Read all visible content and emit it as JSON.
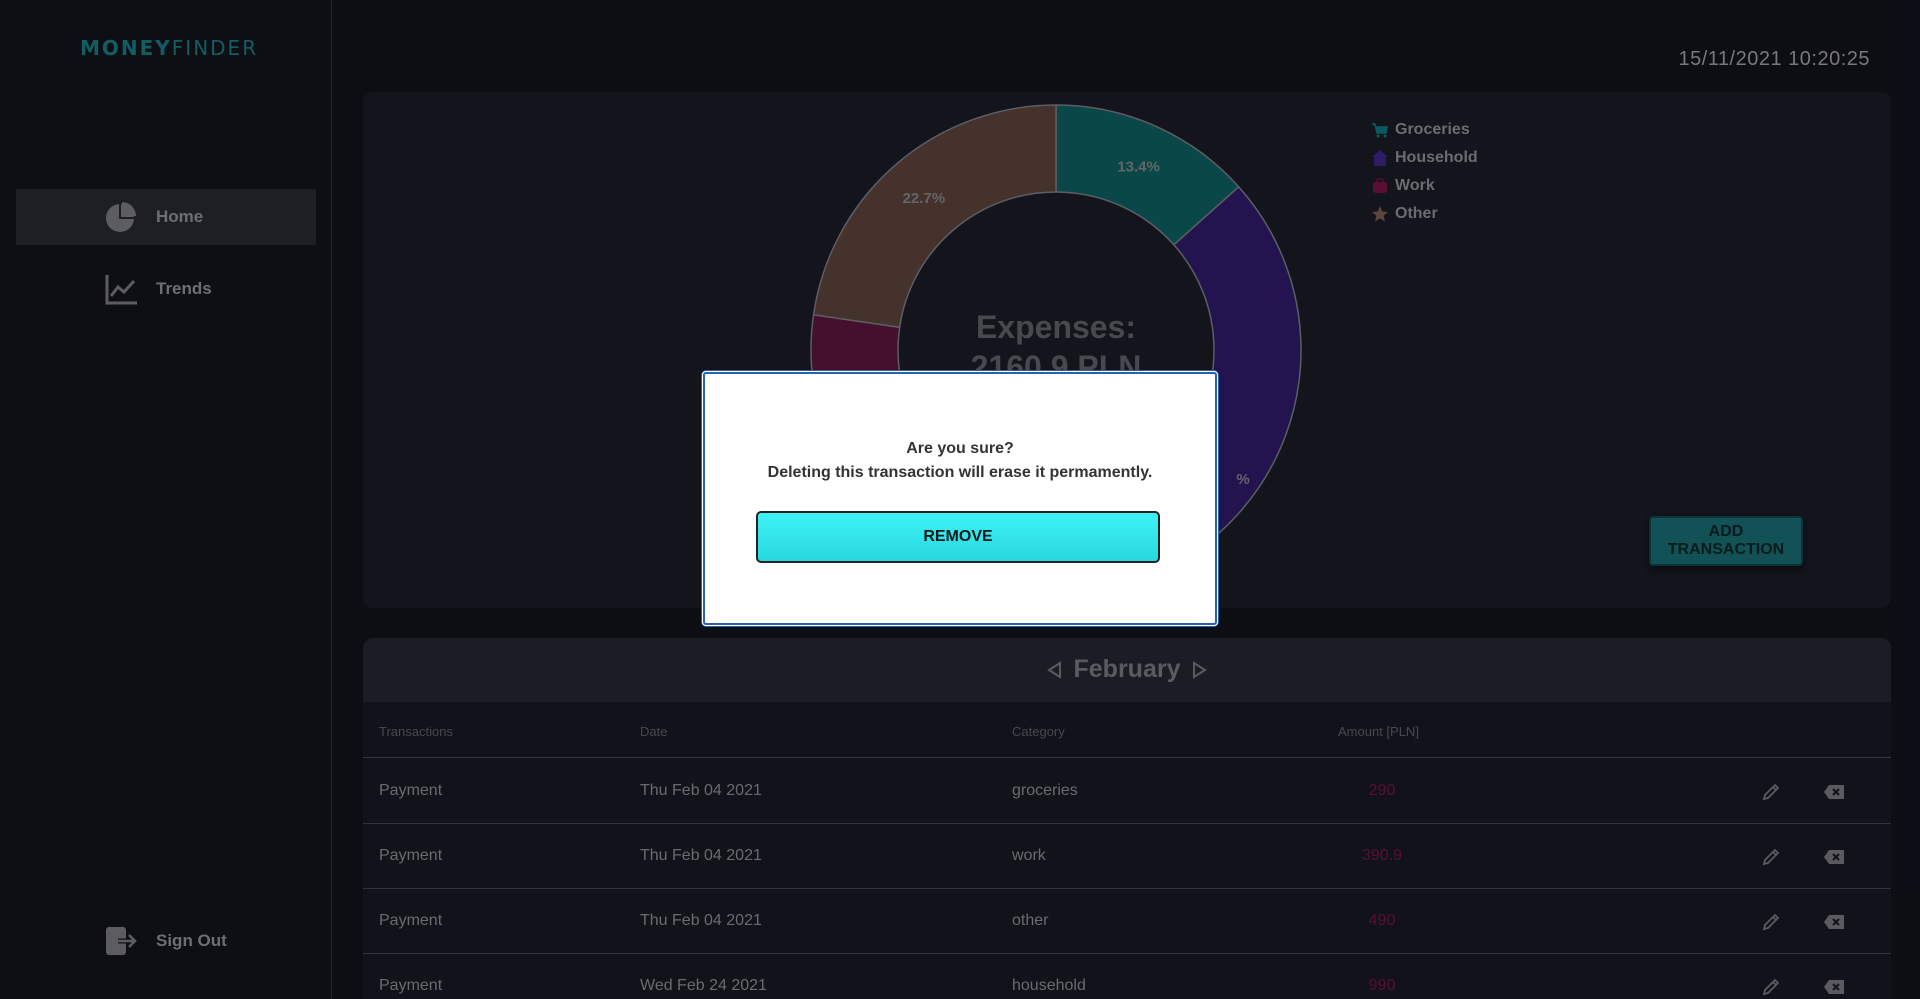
{
  "app": {
    "logo_bold": "MONEY",
    "logo_light": "FINDER"
  },
  "sidebar": {
    "items": [
      {
        "label": "Home",
        "icon": "pie-chart-icon",
        "active": true
      },
      {
        "label": "Trends",
        "icon": "trend-chart-icon",
        "active": false
      }
    ],
    "sign_out": {
      "label": "Sign Out",
      "icon": "sign-out-icon"
    }
  },
  "header": {
    "datetime": "15/11/2021 10:20:25"
  },
  "chart_data": {
    "type": "pie",
    "title": "Expenses:",
    "subtitle": "2160.9 PLN",
    "categories": [
      "Groceries",
      "Household",
      "Work",
      "Other"
    ],
    "values": [
      13.4,
      45.8,
      18.1,
      22.7
    ],
    "visible_labels": [
      "13.4%",
      "%",
      "",
      "22.7%"
    ],
    "colors": [
      "#0e6d6f",
      "#36207a",
      "#6a1748",
      "#6b4e44"
    ],
    "legend_position": "top-right"
  },
  "legend": {
    "items": [
      {
        "label": "Groceries",
        "icon": "cart-icon",
        "color": "#0e8d92"
      },
      {
        "label": "Household",
        "icon": "house-icon",
        "color": "#4a2aa0"
      },
      {
        "label": "Work",
        "icon": "briefcase-icon",
        "color": "#8a1552"
      },
      {
        "label": "Other",
        "icon": "star-icon",
        "color": "#8d6a5c"
      }
    ]
  },
  "actions": {
    "add_transaction": "ADD TRANSACTION"
  },
  "table": {
    "month": "February",
    "headers": [
      "Transactions",
      "Date",
      "Category",
      "Amount [PLN]"
    ],
    "rows": [
      {
        "name": "Payment",
        "date": "Thu Feb 04 2021",
        "category": "groceries",
        "amount": "290"
      },
      {
        "name": "Payment",
        "date": "Thu Feb 04 2021",
        "category": "work",
        "amount": "390.9"
      },
      {
        "name": "Payment",
        "date": "Thu Feb 04 2021",
        "category": "other",
        "amount": "490"
      },
      {
        "name": "Payment",
        "date": "Wed Feb 24 2021",
        "category": "household",
        "amount": "990"
      }
    ]
  },
  "modal": {
    "title": "Are you sure?",
    "message": "Deleting this transaction will erase it permamently.",
    "remove_label": "REMOVE"
  }
}
